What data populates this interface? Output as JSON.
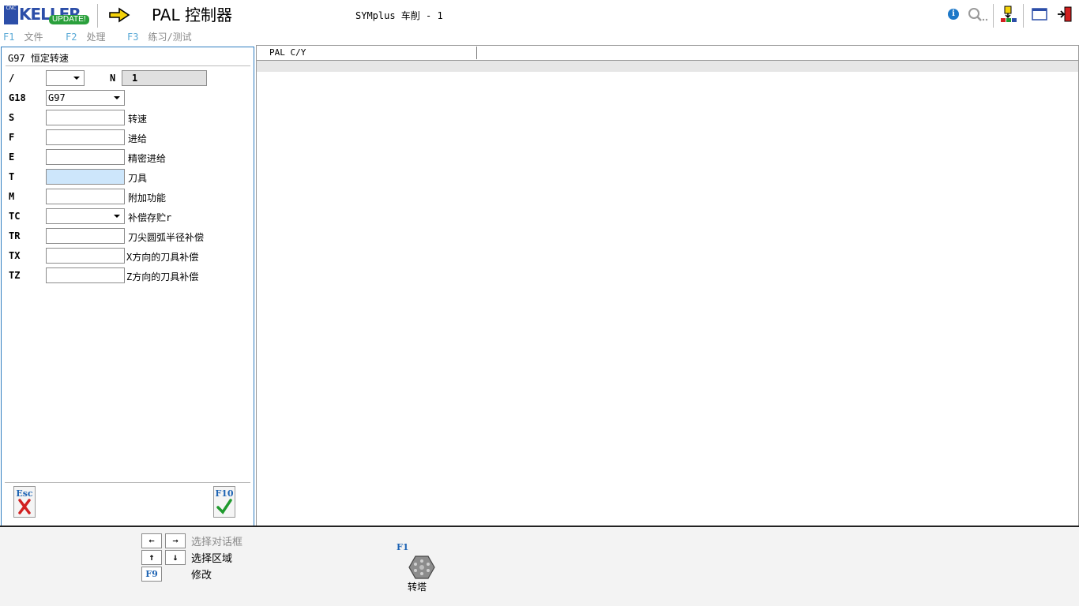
{
  "titlebar": {
    "logo": {
      "cnc": "CNC",
      "brand": "KELLER",
      "update": "UPDATE!"
    },
    "app_title": "PAL 控制器",
    "subtitle": "SYMplus 车削 - 1",
    "icons": [
      "arrow-right-icon",
      "info-icon",
      "search-icon",
      "switch-program-icon",
      "window-icon",
      "exit-icon"
    ]
  },
  "menu": [
    {
      "key": "F1",
      "label": "文件"
    },
    {
      "key": "F2",
      "label": "处理"
    },
    {
      "key": "F3",
      "label": "练习/测试"
    }
  ],
  "dialog": {
    "title": "G97 恒定转速",
    "n_label": "N",
    "n_value": "1",
    "rows": [
      {
        "label": "/",
        "value": "",
        "desc": ""
      },
      {
        "label": "G18",
        "value": "G97",
        "desc": ""
      },
      {
        "label": "S",
        "value": "",
        "desc": "转速"
      },
      {
        "label": "F",
        "value": "",
        "desc": "进给"
      },
      {
        "label": "E",
        "value": "",
        "desc": "精密进给"
      },
      {
        "label": "T",
        "value": "",
        "desc": "刀具"
      },
      {
        "label": "M",
        "value": "",
        "desc": "附加功能"
      },
      {
        "label": "TC",
        "value": "",
        "desc": "补偿存贮r"
      },
      {
        "label": "TR",
        "value": "",
        "desc": "刀尖圆弧半径补偿"
      },
      {
        "label": "TX",
        "value": "",
        "desc": "X方向的刀具补偿"
      },
      {
        "label": "TZ",
        "value": "",
        "desc": "Z方向的刀具补偿"
      }
    ],
    "cancel_key": "Esc",
    "confirm_key": "F10"
  },
  "main": {
    "column_header": "PAL C/Y"
  },
  "footer": {
    "hint_dialog": "选择对话框",
    "hint_area": "选择区域",
    "f9_key": "F9",
    "hint_modify": "修改",
    "f1_key": "F1",
    "turret_label": "转塔"
  },
  "colors": {
    "accent": "#2f7dc0",
    "active_field": "#cde6fb",
    "fkey_text": "#1e64b4",
    "cancel": "#d22020",
    "confirm": "#1f9a2e"
  }
}
